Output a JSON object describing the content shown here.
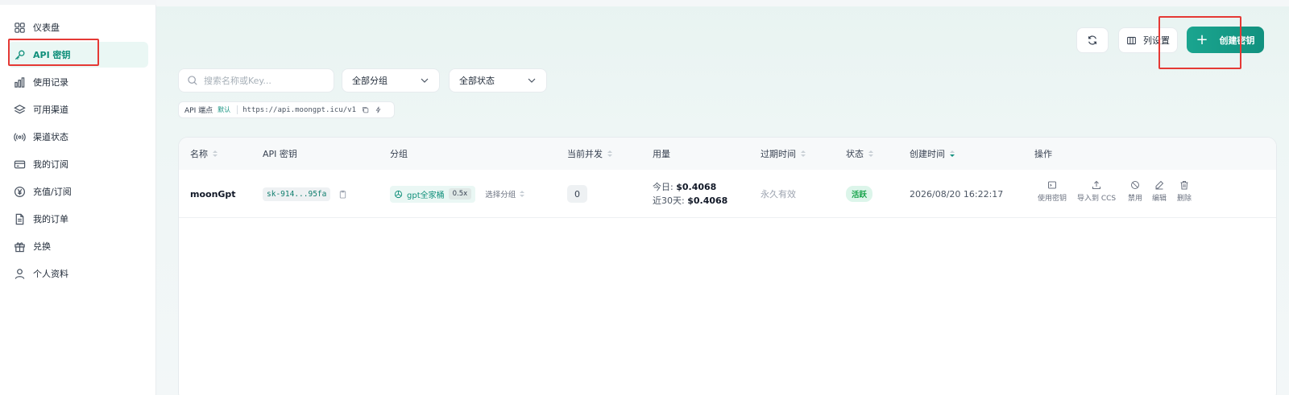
{
  "sidebar": {
    "items": [
      {
        "label": "仪表盘",
        "icon": "dashboard-icon",
        "active": false
      },
      {
        "label": "API 密钥",
        "icon": "key-icon",
        "active": true
      },
      {
        "label": "使用记录",
        "icon": "bar-chart-icon",
        "active": false
      },
      {
        "label": "可用渠道",
        "icon": "layers-icon",
        "active": false
      },
      {
        "label": "渠道状态",
        "icon": "broadcast-icon",
        "active": false
      },
      {
        "label": "我的订阅",
        "icon": "card-icon",
        "active": false
      },
      {
        "label": "充值/订阅",
        "icon": "yen-icon",
        "active": false
      },
      {
        "label": "我的订单",
        "icon": "document-icon",
        "active": false
      },
      {
        "label": "兑换",
        "icon": "gift-icon",
        "active": false
      },
      {
        "label": "个人资料",
        "icon": "user-icon",
        "active": false
      }
    ]
  },
  "toolbar": {
    "refresh_icon": "refresh-icon",
    "columns_label": "列设置",
    "create_label": "创建密钥",
    "create_icon": "plus-icon"
  },
  "filters": {
    "search_placeholder": "搜索名称或Key...",
    "group_select": "全部分组",
    "status_select": "全部状态"
  },
  "endpoint": {
    "label": "API 端点",
    "default_badge": "默认",
    "url": "https://api.moongpt.icu/v1"
  },
  "table": {
    "headers": [
      "名称",
      "API 密钥",
      "分组",
      "当前并发",
      "用量",
      "过期时间",
      "状态",
      "创建时间",
      "操作"
    ],
    "rows": [
      {
        "name": "moonGpt",
        "key": "sk-914...95fa",
        "group": "gpt全家桶",
        "multiplier": "0.5x",
        "choose_group": "选择分组",
        "concurrency": "0",
        "usage_today_label": "今日:",
        "usage_today": "$0.4068",
        "usage_30d_label": "近30天:",
        "usage_30d": "$0.4068",
        "expire": "永久有效",
        "status": "活跃",
        "created": "2026/08/20 16:22:17",
        "actions": [
          "使用密钥",
          "导入到 CCS",
          "禁用",
          "编辑",
          "删除"
        ]
      }
    ]
  },
  "colors": {
    "accent": "#12917f",
    "active_bg": "#eaf7f4",
    "status_green": "#16a34a",
    "highlight_red": "#e53935"
  }
}
